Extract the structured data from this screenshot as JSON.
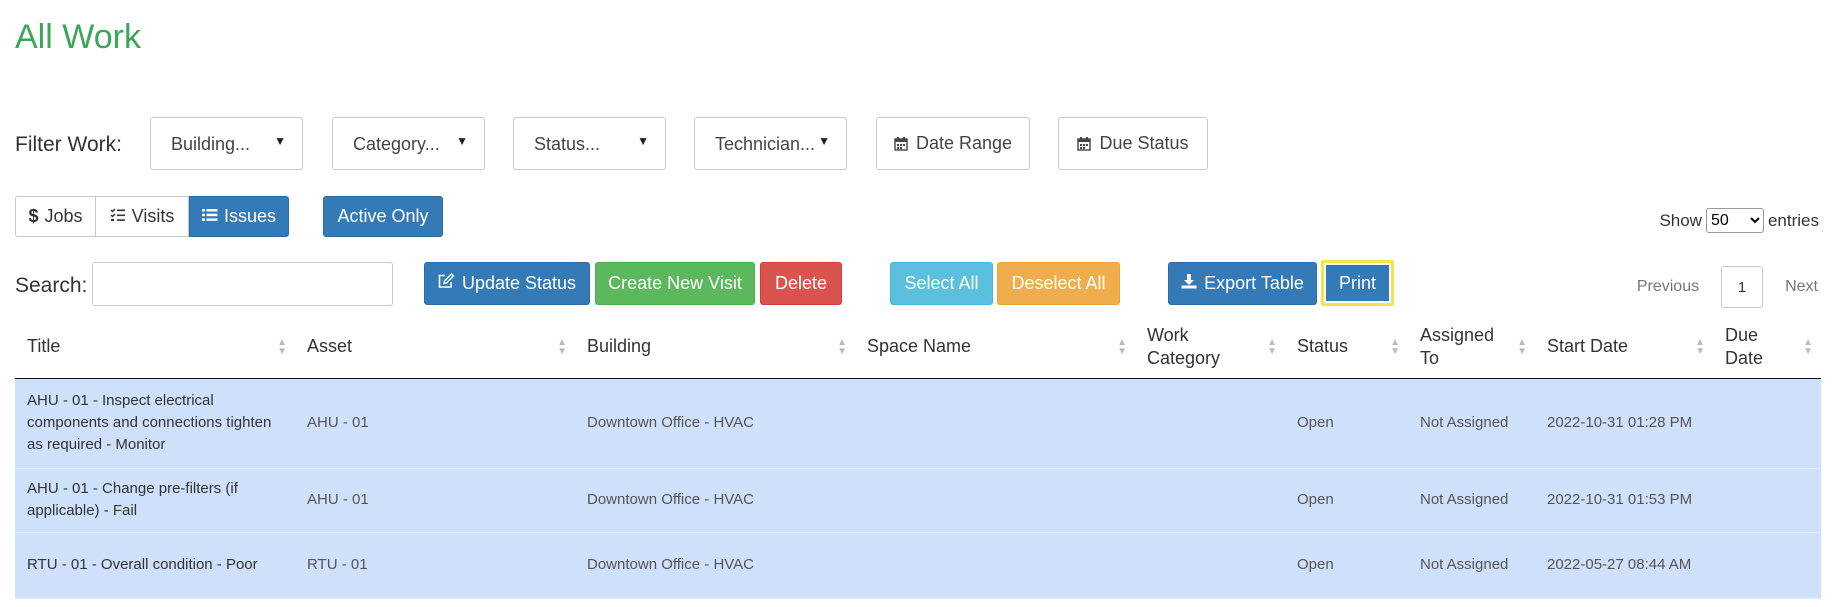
{
  "page": {
    "title": "All Work"
  },
  "filters": {
    "label": "Filter Work:",
    "building": "Building...",
    "category": "Category...",
    "status": "Status...",
    "technician": "Technician...",
    "date_range": "Date Range",
    "due_status": "Due Status"
  },
  "tabs": {
    "jobs": "Jobs",
    "visits": "Visits",
    "issues": "Issues",
    "active_only": "Active Only"
  },
  "entries": {
    "show": "Show",
    "value": "50",
    "suffix": "entries",
    "options": [
      "50"
    ]
  },
  "search": {
    "label": "Search:",
    "value": ""
  },
  "actions": {
    "update_status": "Update Status",
    "create_visit": "Create New Visit",
    "delete": "Delete",
    "select_all": "Select All",
    "deselect_all": "Deselect All",
    "export_table": "Export Table",
    "print": "Print"
  },
  "pagination": {
    "previous": "Previous",
    "page": "1",
    "next": "Next"
  },
  "table": {
    "columns": [
      "Title",
      "Asset",
      "Building",
      "Space Name",
      "Work Category",
      "Status",
      "Assigned To",
      "Start Date",
      "Due Date"
    ],
    "rows": [
      [
        "AHU - 01 - Inspect electrical components and connections tighten as required - Monitor",
        "AHU - 01",
        "Downtown Office - HVAC",
        "",
        "",
        "Open",
        "Not Assigned",
        "2022-10-31 01:28 PM",
        ""
      ],
      [
        "AHU - 01 - Change pre-filters (if applicable) - Fail",
        "AHU - 01",
        "Downtown Office - HVAC",
        "",
        "",
        "Open",
        "Not Assigned",
        "2022-10-31 01:53 PM",
        ""
      ],
      [
        "RTU - 01 - Overall condition - Poor",
        "RTU - 01",
        "Downtown Office - HVAC",
        "",
        "",
        "Open",
        "Not Assigned",
        "2022-05-27 08:44 AM",
        ""
      ]
    ]
  },
  "colors": {
    "title_green": "#3aa757",
    "primary": "#337ab7",
    "success": "#5cb85c",
    "danger": "#d9534f",
    "info": "#5bc0de",
    "warning": "#f0ad4e",
    "row_highlight": "#cfe0fb",
    "focus_ring": "#f2e44a"
  },
  "icons": {
    "jobs": "dollar-icon",
    "visits": "checklist-icon",
    "issues": "list-icon",
    "update_status": "edit-icon",
    "export_table": "download-icon",
    "date_range": "calendar-icon"
  }
}
